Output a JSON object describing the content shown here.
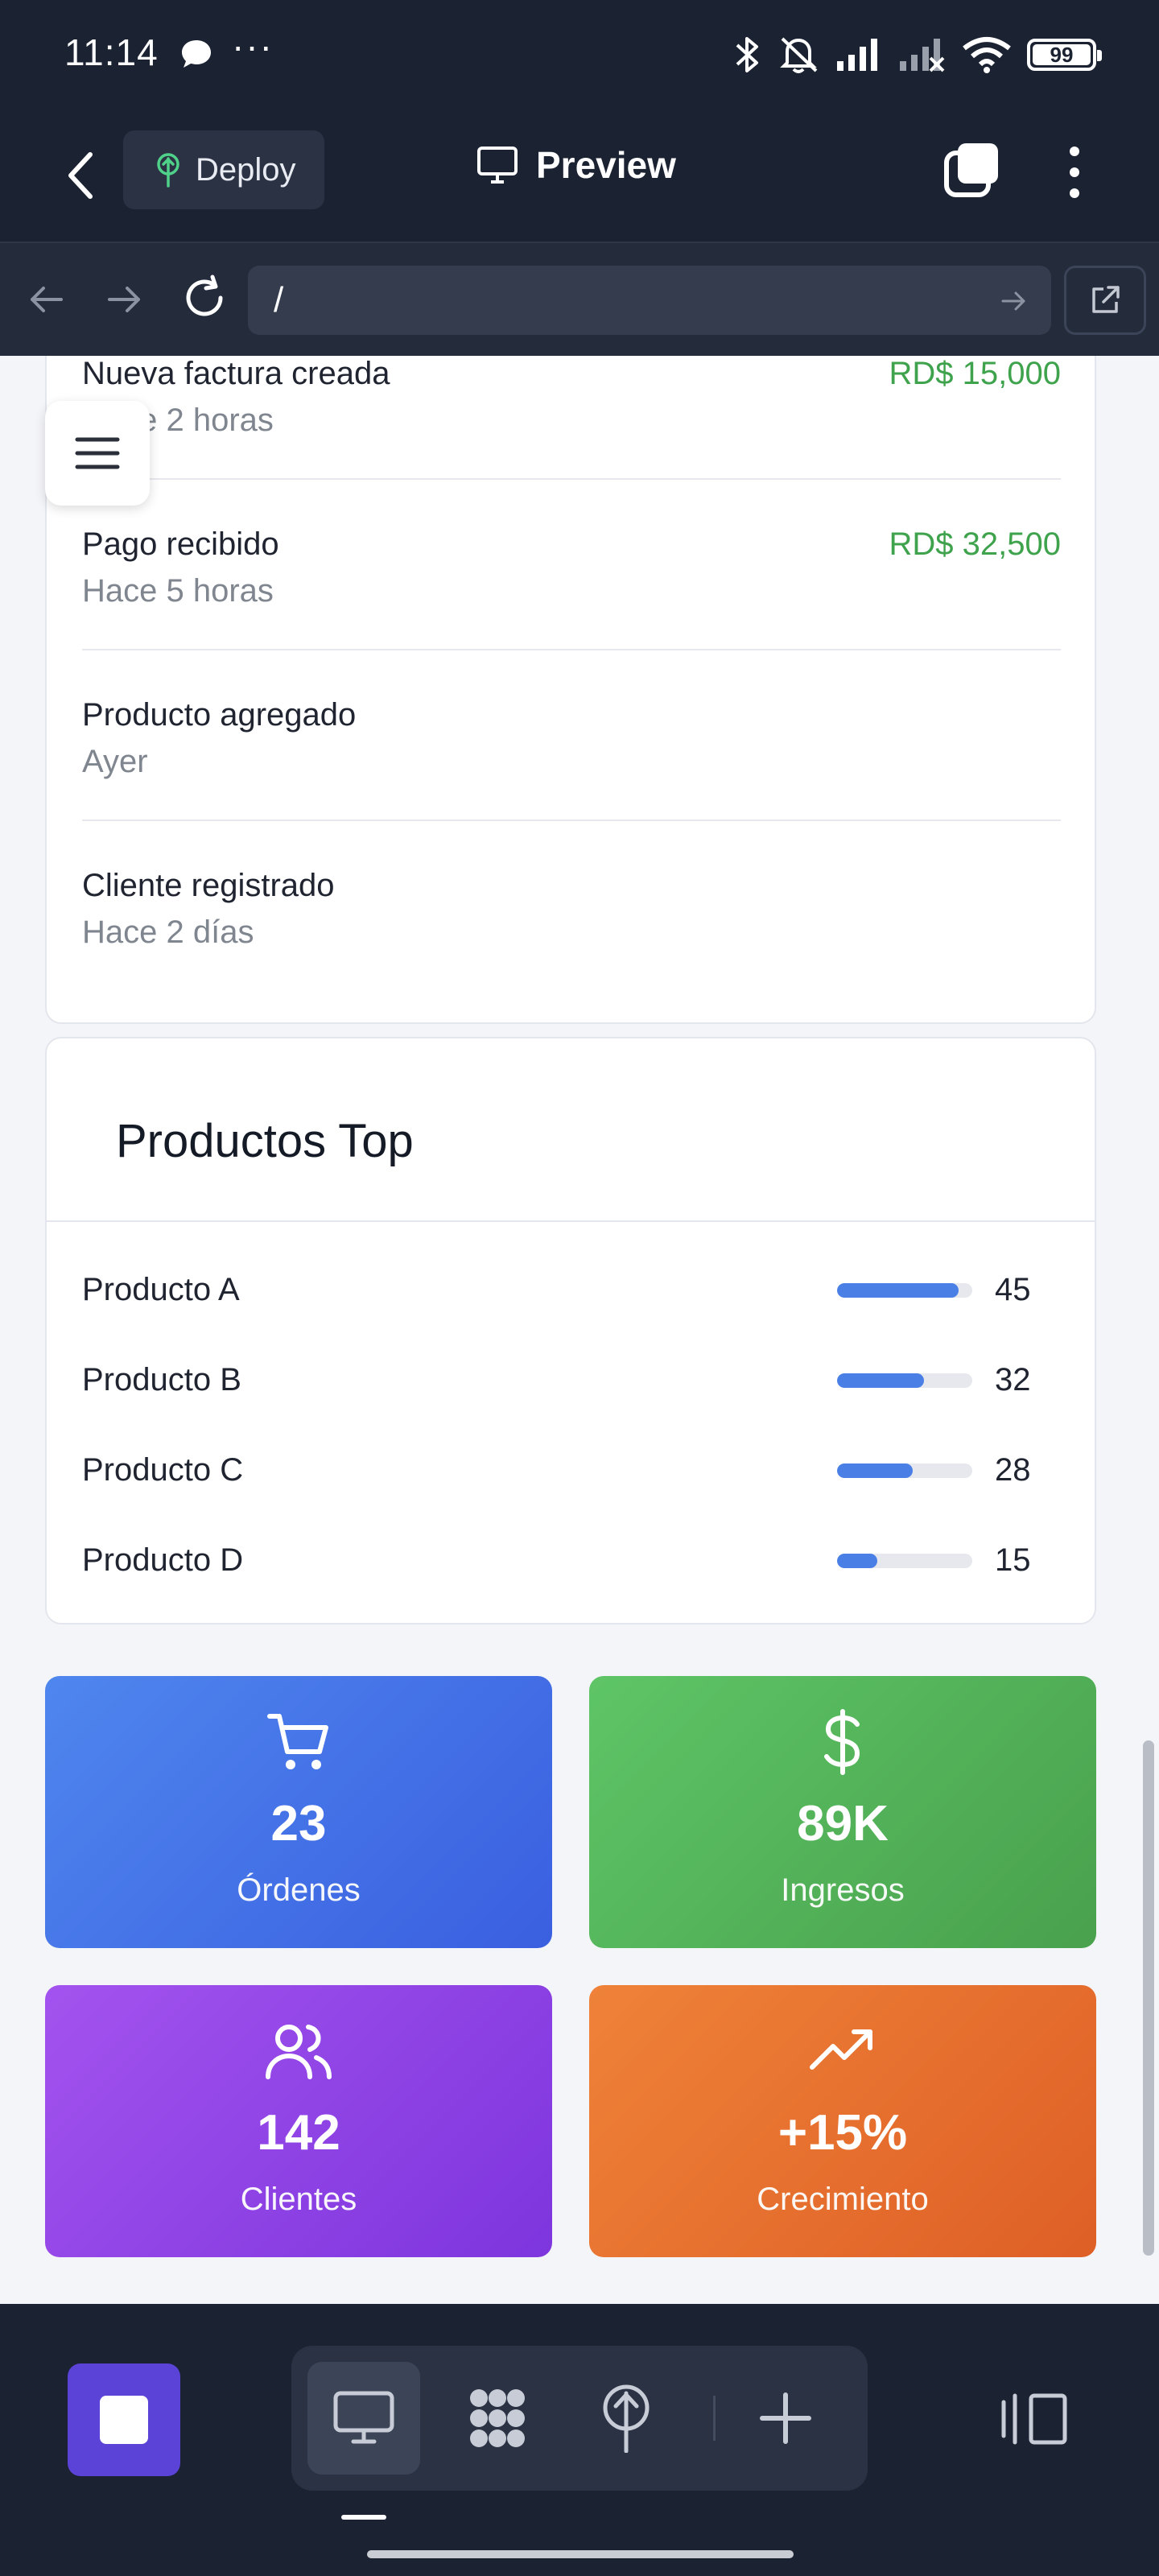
{
  "status_bar": {
    "time": "11:14",
    "more": "···",
    "battery": "99"
  },
  "toolbar": {
    "deploy_label": "Deploy",
    "preview_label": "Preview"
  },
  "url_bar": {
    "url": "/"
  },
  "activity": {
    "items": [
      {
        "title": "Nueva factura creada",
        "time": "Hace 2 horas",
        "amount": "RD$ 15,000"
      },
      {
        "title": "Pago recibido",
        "time": "Hace 5 horas",
        "amount": "RD$ 32,500"
      },
      {
        "title": "Producto agregado",
        "time": "Ayer",
        "amount": ""
      },
      {
        "title": "Cliente registrado",
        "time": "Hace 2 días",
        "amount": ""
      }
    ]
  },
  "products": {
    "title": "Productos Top",
    "items": [
      {
        "name": "Producto A",
        "value": 45,
        "value_text": "45"
      },
      {
        "name": "Producto B",
        "value": 32,
        "value_text": "32"
      },
      {
        "name": "Producto C",
        "value": 28,
        "value_text": "28"
      },
      {
        "name": "Producto D",
        "value": 15,
        "value_text": "15"
      }
    ]
  },
  "stats": {
    "orders": {
      "value": "23",
      "label": "Órdenes",
      "icon": "cart-icon"
    },
    "revenue": {
      "value": "89K",
      "label": "Ingresos",
      "icon": "dollar-icon"
    },
    "clients": {
      "value": "142",
      "label": "Clientes",
      "icon": "users-icon"
    },
    "growth": {
      "value": "+15%",
      "label": "Crecimiento",
      "icon": "trending-up-icon"
    }
  },
  "colors": {
    "accent_blue": "#4a7fe6",
    "amount_green": "#3fa34d",
    "stop_purple": "#5b43d8"
  }
}
